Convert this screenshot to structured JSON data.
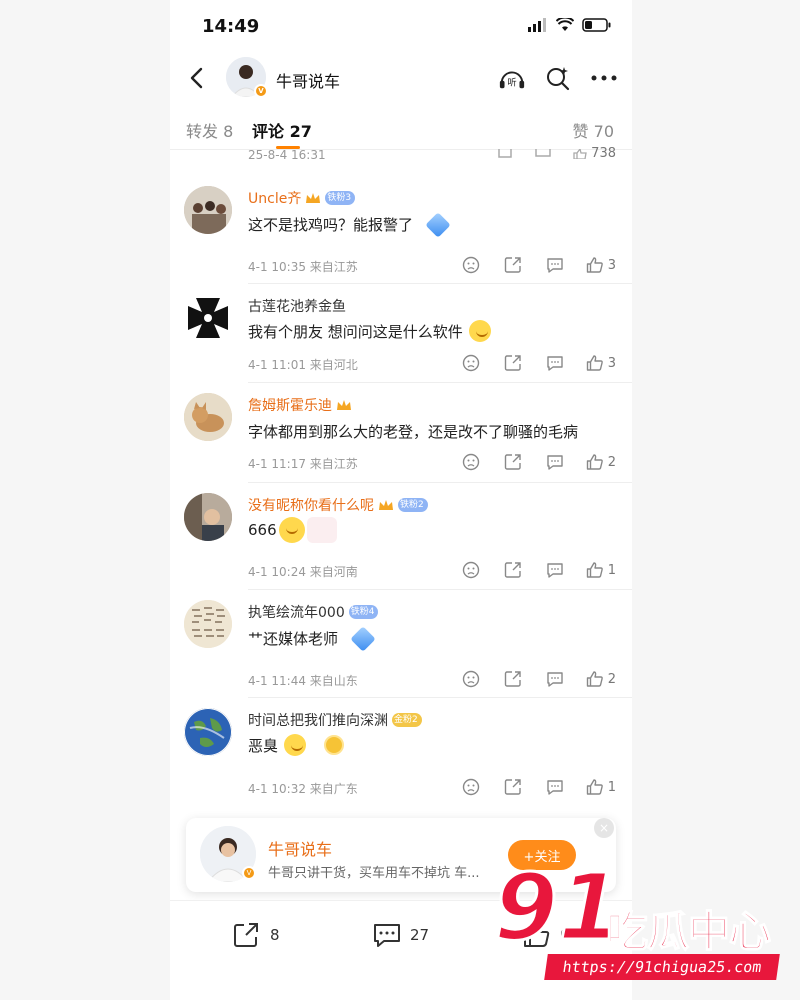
{
  "status_bar": {
    "time": "14:49"
  },
  "nav": {
    "title": "牛哥说车",
    "listen_label": "听"
  },
  "tabs": [
    {
      "label": "转发 8"
    },
    {
      "label": "评论 27"
    },
    {
      "label": "赞 70"
    }
  ],
  "previous_comment": {
    "meta": "25-8-4 16:31",
    "likes": "738"
  },
  "comments": [
    {
      "name": "Uncle齐",
      "badge": "铁粉3",
      "text": "这不是找鸡吗？能报警了",
      "meta": "4-1 10:35  来自江苏",
      "likes": "3"
    },
    {
      "name": "古莲花池养金鱼",
      "badge": "",
      "text": "我有个朋友  想问问这是什么软件",
      "meta": "4-1 11:01  来自河北",
      "likes": "3"
    },
    {
      "name": "詹姆斯霍乐迪",
      "badge": "",
      "text": "字体都用到那么大的老登，还是改不了聊骚的毛病",
      "meta": "4-1 11:17  来自江苏",
      "likes": "2"
    },
    {
      "name": "没有昵称你看什么呢",
      "badge": "铁粉2",
      "text": "666",
      "meta": "4-1 10:24  来自河南",
      "likes": "1"
    },
    {
      "name": "执笔绘流年000",
      "badge": "铁粉4",
      "text": "艹还媒体老师",
      "meta": "4-1 11:44  来自山东",
      "likes": "2"
    },
    {
      "name": "时间总把我们推向深渊",
      "badge": "金粉2",
      "text": "恶臭",
      "meta": "4-1 10:32  来自广东",
      "likes": "1"
    }
  ],
  "follow_card": {
    "name": "牛哥说车",
    "desc": "牛哥只讲干货，买车用车不掉坑 车...",
    "follow_label": "+关注",
    "close": "×"
  },
  "bottom_bar": {
    "reposts": "8",
    "comments": "27",
    "likes": "0"
  },
  "watermark": {
    "number": "91",
    "brand": "吃瓜中心",
    "url": "https://91chigua25.com"
  },
  "colors": {
    "accent": "#ff8200",
    "name_orange": "#e86f1a",
    "watermark_red": "#e8173c"
  }
}
